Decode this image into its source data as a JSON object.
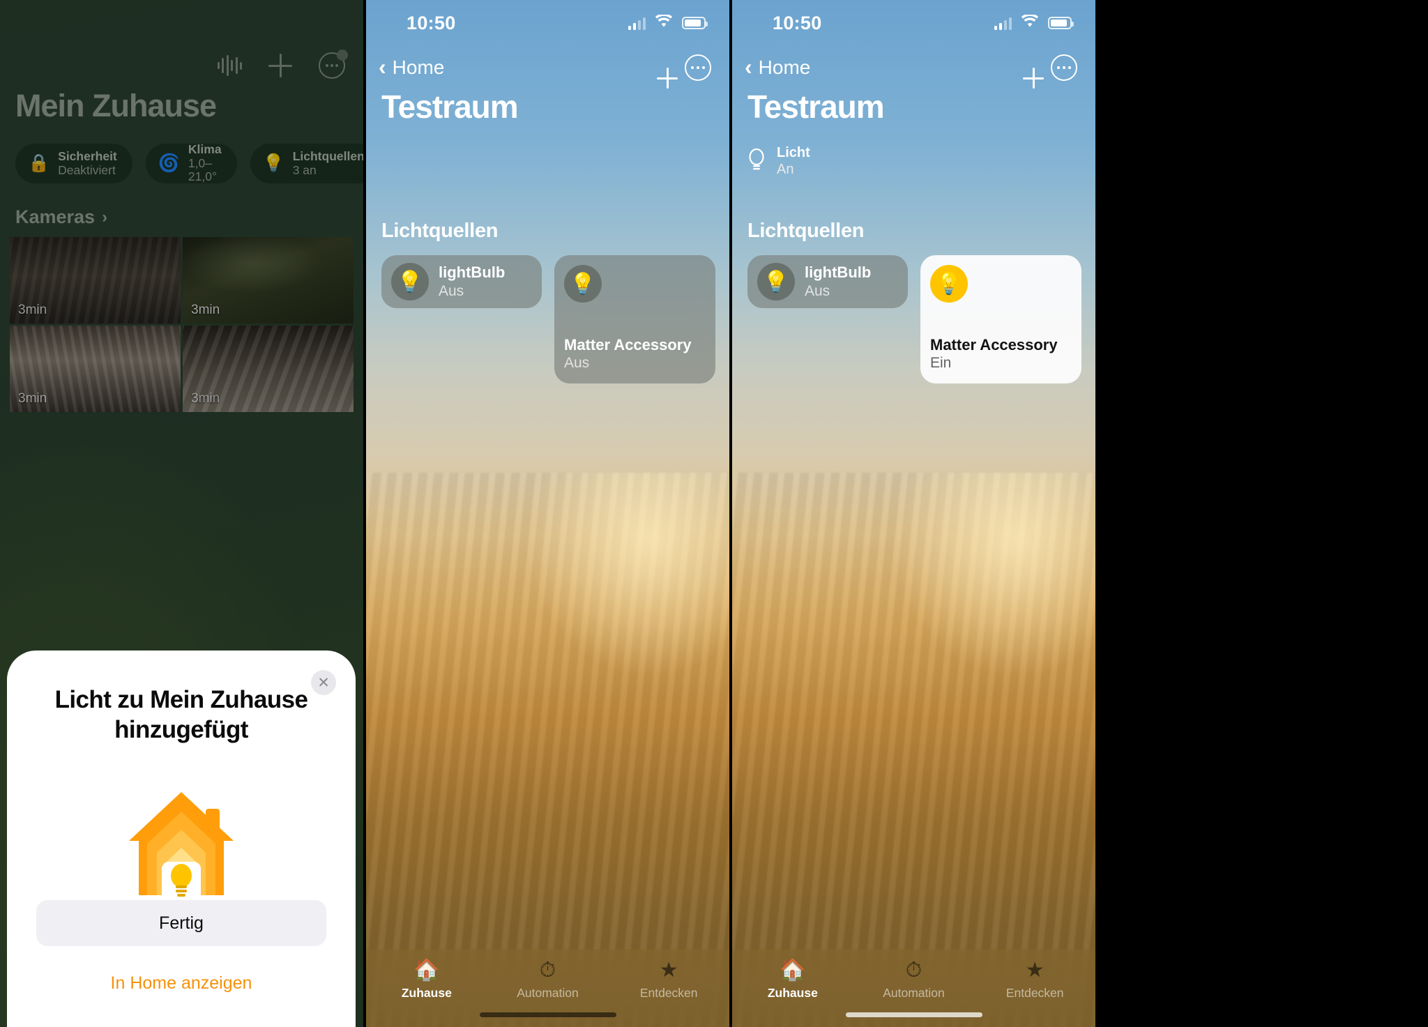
{
  "panel1": {
    "top_icons": [
      {
        "name": "waveform-icon",
        "glyph": "waveform"
      },
      {
        "name": "add-icon",
        "glyph": "+"
      },
      {
        "name": "more-icon",
        "glyph": "..."
      }
    ],
    "title": "Mein Zuhause",
    "chips": [
      {
        "icon": "lock-icon",
        "glyph": "🔒",
        "label": "Sicherheit",
        "value": "Deaktiviert"
      },
      {
        "icon": "fan-icon",
        "glyph": "🌀",
        "label": "Klima",
        "value": "1,0–21,0°"
      },
      {
        "icon": "lightbulb-icon",
        "glyph": "💡",
        "label": "Lichtquellen",
        "value": "3 an"
      }
    ],
    "section_title": "Kameras",
    "section_chevron": "›",
    "cameras": [
      {
        "name": "camera-tile-1",
        "stamp": "3min"
      },
      {
        "name": "camera-tile-2",
        "stamp": "3min"
      },
      {
        "name": "camera-tile-3",
        "stamp": "3min"
      },
      {
        "name": "camera-tile-4",
        "stamp": "3min"
      }
    ],
    "sheet": {
      "close_glyph": "✕",
      "title": "Licht zu Mein Zuhause hinzugefügt",
      "icon": "home-with-bulb-icon",
      "primary_button": "Fertig",
      "link": "In Home anzeigen",
      "link_color": "#f5920b"
    }
  },
  "panel2": {
    "status": {
      "time": "10:50",
      "signal": "cellular-icon",
      "wifi": "wifi-icon",
      "battery": "battery-icon"
    },
    "nav": {
      "back_label": "Home",
      "back_glyph": "‹",
      "add_glyph": "+",
      "more_glyph": "..."
    },
    "title": "Testraum",
    "section_title": "Lichtquellen",
    "cards": [
      {
        "name": "lightbulb",
        "icon": "lightbulb-icon",
        "glyph": "💡",
        "title": "lightBulb",
        "state": "Aus",
        "on": false,
        "size": "small"
      },
      {
        "name": "matter-accessory",
        "icon": "lightbulb-icon",
        "glyph": "💡",
        "title": "Matter Accessory",
        "state": "Aus",
        "on": false,
        "size": "large"
      }
    ],
    "tabs": [
      {
        "name": "tab-zuhause",
        "glyph": "🏠",
        "label": "Zuhause",
        "active": true
      },
      {
        "name": "tab-automation",
        "glyph": "⏱",
        "label": "Automation",
        "active": false
      },
      {
        "name": "tab-entdecken",
        "glyph": "★",
        "label": "Entdecken",
        "active": false
      }
    ]
  },
  "panel3": {
    "status": {
      "time": "10:50",
      "signal": "cellular-icon",
      "wifi": "wifi-icon",
      "battery": "battery-icon"
    },
    "nav": {
      "back_label": "Home",
      "back_glyph": "‹",
      "add_glyph": "+",
      "more_glyph": "..."
    },
    "title": "Testraum",
    "summary": {
      "icon": "lightbulb-icon",
      "glyph": "💡",
      "label": "Licht",
      "value": "An"
    },
    "section_title": "Lichtquellen",
    "cards": [
      {
        "name": "lightbulb",
        "icon": "lightbulb-icon",
        "glyph": "💡",
        "title": "lightBulb",
        "state": "Aus",
        "on": false,
        "size": "small"
      },
      {
        "name": "matter-accessory",
        "icon": "lightbulb-icon",
        "glyph": "💡",
        "title": "Matter Accessory",
        "state": "Ein",
        "on": true,
        "size": "large"
      }
    ],
    "tabs": [
      {
        "name": "tab-zuhause",
        "glyph": "🏠",
        "label": "Zuhause",
        "active": true
      },
      {
        "name": "tab-automation",
        "glyph": "⏱",
        "label": "Automation",
        "active": false
      },
      {
        "name": "tab-entdecken",
        "glyph": "★",
        "label": "Entdecken",
        "active": false
      }
    ]
  },
  "colors": {
    "accent_orange": "#f5920b",
    "bulb_yellow": "#ffc400",
    "card_on_bg": "#fcfcfc"
  }
}
